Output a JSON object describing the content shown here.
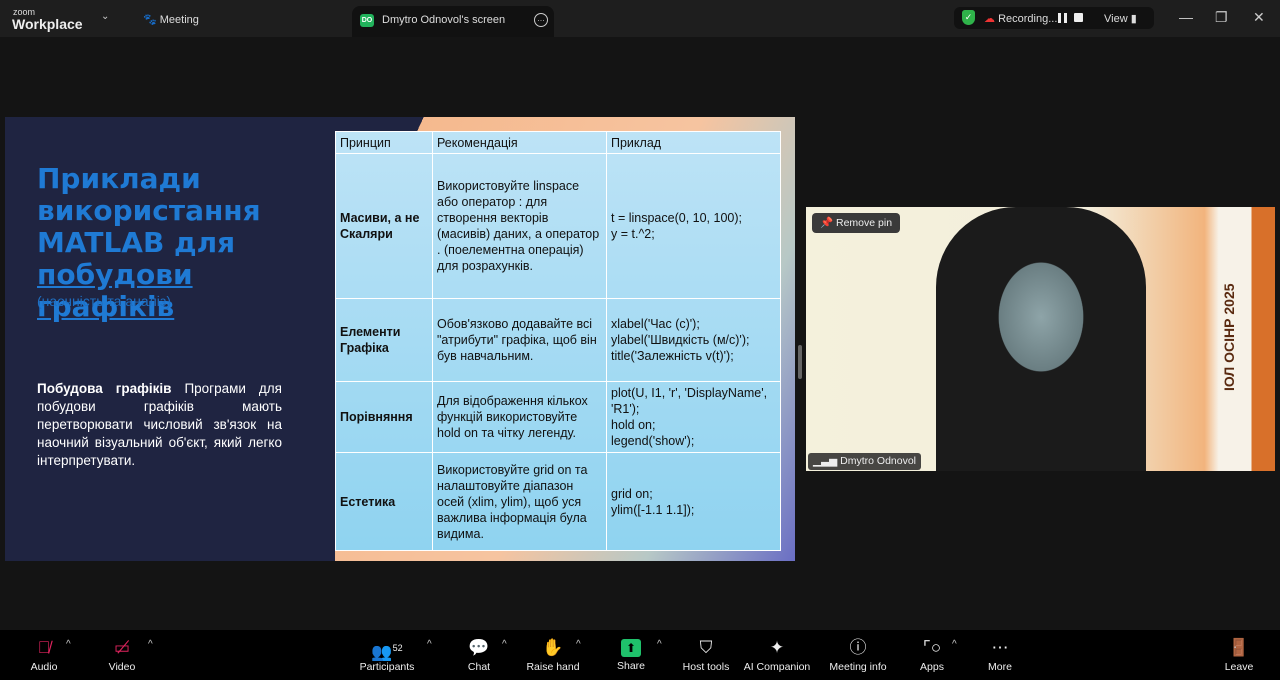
{
  "app": {
    "brand_small": "zoom",
    "brand_large": "Workplace",
    "meeting_label": "Meeting"
  },
  "tab": {
    "icon_text": "DO",
    "label": "Dmytro Odnovol's screen"
  },
  "recording": {
    "label": "Recording...",
    "view_label": "View"
  },
  "slide": {
    "title_lines": [
      "Приклади",
      "використання",
      "MATLAB для"
    ],
    "title_link": "побудови графіків",
    "subtitle": "(наочність та аналіз)",
    "body_bold": "Побудова графіків",
    "body_text": " Програми для побудови графіків мають перетворювати числовий зв'язок на наочний візуальний об'єкт, який легко інтерпретувати.",
    "table": {
      "headers": [
        "Принцип",
        "Рекомендація",
        "Приклад"
      ],
      "rows": [
        {
          "principle": "Масиви, а не Скаляри",
          "recommendation": "Використовуйте linspace або оператор : для створення векторів (масивів) даних, а оператор . (поелементна операція) для розрахунків.",
          "example": [
            "t = linspace(0, 10, 100);",
            "y = t.^2;"
          ]
        },
        {
          "principle": "Елементи Графіка",
          "recommendation": "Обов'язково додавайте всі \"атрибути\" графіка, щоб він був навчальним.",
          "example": [
            "xlabel('Час (с)');",
            "ylabel('Швидкість (м/с)');",
            "title('Залежність v(t)');"
          ]
        },
        {
          "principle": "Порівняння",
          "recommendation": "Для відображення кількох функцій використовуйте hold on та чітку легенду.",
          "example": [
            "plot(U, I1, 'r', 'DisplayName',",
            "'R1');",
            "hold on;",
            "legend('show');"
          ]
        },
        {
          "principle": "Естетика",
          "recommendation": "Використовуйте grid on та налаштовуйте діапазон осей (xlim, ylim), щоб уся важлива інформація була видима.",
          "example": [
            "grid on;",
            "ylim([-1.1 1.1]);"
          ]
        }
      ]
    }
  },
  "video": {
    "remove_pin": "Remove pin",
    "participant_name": "Dmytro Odnovol",
    "banner": "ІОЛ ОСІНР 2025"
  },
  "toolbar": {
    "audio": "Audio",
    "video": "Video",
    "participants": "Participants",
    "participants_count": "52",
    "chat": "Chat",
    "raise_hand": "Raise hand",
    "share": "Share",
    "host_tools": "Host tools",
    "ai_companion": "AI Companion",
    "meeting_info": "Meeting info",
    "apps": "Apps",
    "more": "More",
    "leave": "Leave"
  }
}
